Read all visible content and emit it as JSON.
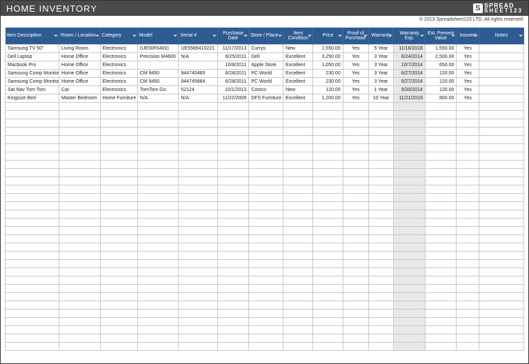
{
  "header": {
    "title": "HOME INVENTORY"
  },
  "logo": {
    "icon": "S",
    "line1": "SPREAD",
    "line2": "SHEET",
    "suffix": "123"
  },
  "copyright": "© 2013 Spreadsheet123 LTD. All rights reserved",
  "columns": [
    "Item Description",
    "Room / Location",
    "Category",
    "Model",
    "Serial #",
    "Purchase Date",
    "Store / Place",
    "Item Condition",
    "Price",
    "Proof of Purchase",
    "Warranty",
    "Warranty Exp.",
    "Est. Present Value",
    "Insured",
    "Notes"
  ],
  "rows": [
    {
      "desc": "Samsung TV 50\"",
      "room": "Living Room",
      "cat": "Electronics",
      "model": "(UE50F6400)",
      "serial": "UE5589410221",
      "pdate": "11/17/2013",
      "store": "Currys",
      "cond": "New",
      "price": "1,550.00",
      "proof": "Yes",
      "warr": "5 Year",
      "wexp": "11/16/2018",
      "val": "1,550.00",
      "ins": "Yes",
      "notes": ""
    },
    {
      "desc": "Dell Laptop",
      "room": "Home Office",
      "cat": "Electronics",
      "model": "Precision M4600",
      "serial": "N/A",
      "pdate": "6/25/2011",
      "store": "Dell",
      "cond": "Excellent",
      "price": "3,250.00",
      "proof": "Yes",
      "warr": "3 Year",
      "wexp": "6/24/2014",
      "val": "2,500.00",
      "ins": "Yes",
      "notes": ""
    },
    {
      "desc": "Macbook Pro",
      "room": "Home Office",
      "cat": "Electronics",
      "model": "",
      "serial": "",
      "pdate": "10/8/2011",
      "store": "Apple Store",
      "cond": "Excellent",
      "price": "1,050.00",
      "proof": "Yes",
      "warr": "3 Year",
      "wexp": "10/7/2014",
      "val": "650.00",
      "ins": "Yes",
      "notes": ""
    },
    {
      "desc": "Samsung Comp Monitor",
      "room": "Home Office",
      "cat": "Electronics",
      "model": "CM 9450",
      "serial": "944745485",
      "pdate": "6/28/2011",
      "store": "PC World",
      "cond": "Excellent",
      "price": "230.00",
      "proof": "Yes",
      "warr": "3 Year",
      "wexp": "6/27/2014",
      "val": "120.00",
      "ins": "Yes",
      "notes": ""
    },
    {
      "desc": "Samsung Comp Monitor",
      "room": "Home Office",
      "cat": "Electronics",
      "model": "CM 9450",
      "serial": "944745884",
      "pdate": "6/28/2011",
      "store": "PC World",
      "cond": "Excellent",
      "price": "230.00",
      "proof": "Yes",
      "warr": "3 Year",
      "wexp": "6/27/2014",
      "val": "120.00",
      "ins": "Yes",
      "notes": ""
    },
    {
      "desc": "Sat Nav Tom Tom",
      "room": "Car",
      "cat": "Electronics",
      "model": "TomTom Go",
      "serial": "52124",
      "pdate": "10/1/2013",
      "store": "Costco",
      "cond": "New",
      "price": "120.00",
      "proof": "Yes",
      "warr": "1 Year",
      "wexp": "9/30/2014",
      "val": "120.00",
      "ins": "Yes",
      "notes": ""
    },
    {
      "desc": "Kingsize Bed",
      "room": "Master Bedroom",
      "cat": "Home Furniture",
      "model": "N/A",
      "serial": "N/A",
      "pdate": "11/22/2009",
      "store": "DFS Furniture",
      "cond": "Excellent",
      "price": "1,200.00",
      "proof": "Yes",
      "warr": "10 Year",
      "wexp": "11/21/2019",
      "val": "800.00",
      "ins": "Yes",
      "notes": ""
    }
  ],
  "empty_rows": 30
}
